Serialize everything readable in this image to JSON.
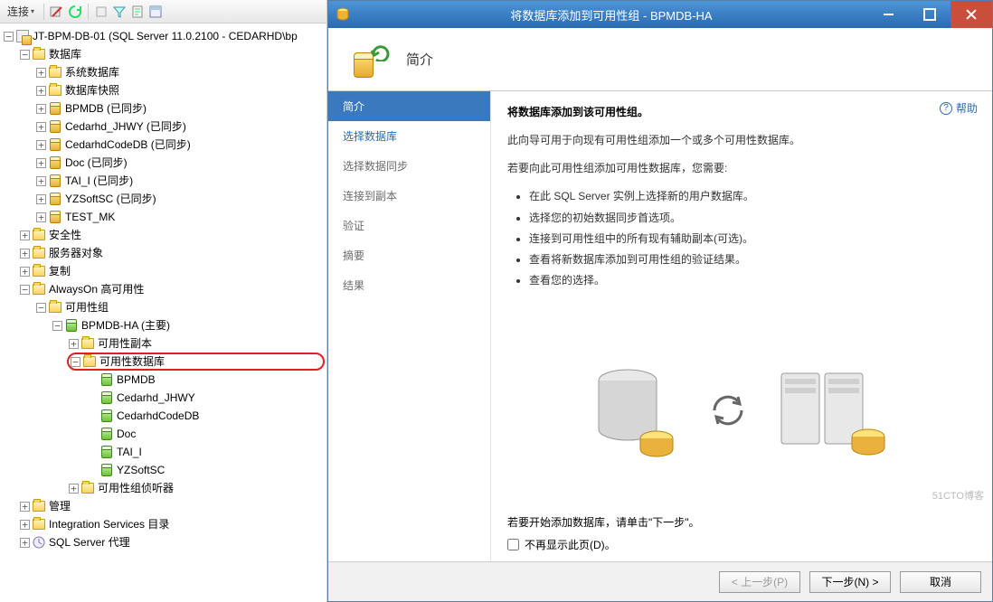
{
  "toolbar": {
    "connect_label": "连接"
  },
  "tree": {
    "server": "JT-BPM-DB-01 (SQL Server 11.0.2100 - CEDARHD\\bp",
    "databases": "数据库",
    "sys_db": "系统数据库",
    "db_snapshot": "数据库快照",
    "db_items": [
      "BPMDB (已同步)",
      "Cedarhd_JHWY (已同步)",
      "CedarhdCodeDB (已同步)",
      "Doc (已同步)",
      "TAI_I (已同步)",
      "YZSoftSC (已同步)",
      "TEST_MK"
    ],
    "security": "安全性",
    "server_objects": "服务器对象",
    "replication": "复制",
    "alwayson": "AlwaysOn 高可用性",
    "ag_group": "可用性组",
    "ag_name": "BPMDB-HA (主要)",
    "ag_replicas": "可用性副本",
    "ag_databases": "可用性数据库",
    "ag_db_items": [
      "BPMDB",
      "Cedarhd_JHWY",
      "CedarhdCodeDB",
      "Doc",
      "TAI_I",
      "YZSoftSC"
    ],
    "ag_listeners": "可用性组侦听器",
    "management": "管理",
    "isc": "Integration Services 目录",
    "sqlagent": "SQL Server 代理"
  },
  "dialog": {
    "window_title": "将数据库添加到可用性组 - BPMDB-HA",
    "banner_title": "简介",
    "steps": [
      "简介",
      "选择数据库",
      "选择数据同步",
      "连接到副本",
      "验证",
      "摘要",
      "结果"
    ],
    "help": "帮助",
    "heading": "将数据库添加到该可用性组。",
    "para1": "此向导可用于向现有可用性组添加一个或多个可用性数据库。",
    "para2": "若要向此可用性组添加可用性数据库，您需要:",
    "bullets": [
      "在此 SQL Server 实例上选择新的用户数据库。",
      "选择您的初始数据同步首选项。",
      "连接到可用性组中的所有现有辅助副本(可选)。",
      "查看将新数据库添加到可用性组的验证结果。",
      "查看您的选择。"
    ],
    "start_hint": "若要开始添加数据库，请单击\"下一步\"。",
    "dont_show": "不再显示此页(D)。",
    "btn_prev": "< 上一步(P)",
    "btn_next": "下一步(N) >",
    "btn_cancel": "取消"
  },
  "watermark": "51CTO博客"
}
